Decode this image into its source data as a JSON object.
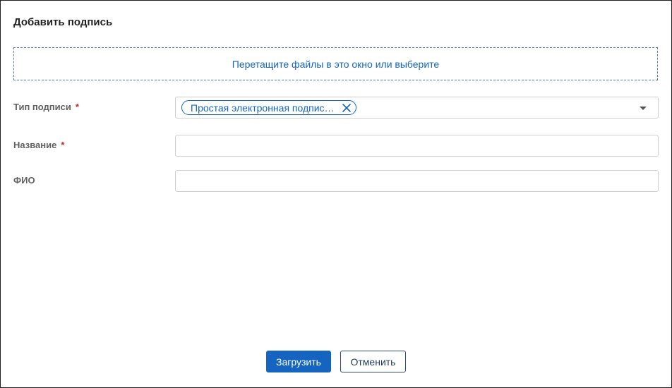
{
  "dialog": {
    "title": "Добавить подпись"
  },
  "dropzone": {
    "text": "Перетащите файлы в это окно или выберите"
  },
  "fields": {
    "signature_type": {
      "label": "Тип подписи",
      "required_mark": "*",
      "selected_chip": "Простая электронная подпис…"
    },
    "name": {
      "label": "Название",
      "required_mark": "*",
      "value": ""
    },
    "fio": {
      "label": "ФИО",
      "value": ""
    }
  },
  "actions": {
    "upload_label": "Загрузить",
    "cancel_label": "Отменить"
  },
  "icons": {
    "chip_close": "close-icon",
    "dropdown": "chevron-down-icon"
  },
  "colors": {
    "accent": "#1565c0",
    "required": "#c62828",
    "label": "#616161",
    "border": "#cfcfcf"
  }
}
